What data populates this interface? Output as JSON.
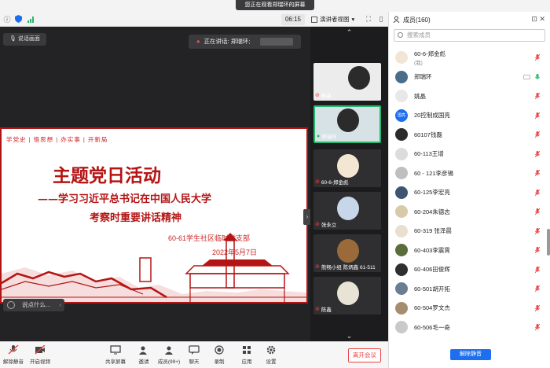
{
  "banner": "您正在观看郑瑞环的屏幕",
  "topbar": {
    "time": "06:15",
    "view_label": "演讲者视图"
  },
  "main": {
    "speaker_view_label": "说话画面",
    "speaking_label": "正在讲话: 郑瑞环;",
    "chat_placeholder": "说点什么..."
  },
  "slide": {
    "topline": "学党史 | 悟思想 | 办实事 | 开新局",
    "title": "主题党日活动",
    "subtitle1": "——学习习近平总书记在中国人民大学",
    "subtitle2": "考察时重要讲话精神",
    "org": "60-61学生社区临时党支部",
    "date": "2022年5月7日"
  },
  "videos": [
    {
      "name": "杨路"
    },
    {
      "name": "郑瑞环"
    },
    {
      "name": "60-6-郑金彪"
    },
    {
      "name": "张永立"
    },
    {
      "name": "熊畅小组 陈炳鑫 61-511"
    },
    {
      "name": "陈鑫"
    }
  ],
  "panel": {
    "title": "成员(160)",
    "search_placeholder": "搜索成员",
    "unmute_all": "解除静音",
    "members": [
      {
        "name": "60-6-郑金彪",
        "sub": "(我)",
        "avatar_color": "#f1e6d6",
        "avatar_text": ""
      },
      {
        "name": "郑瑞环",
        "sub": "",
        "avatar_color": "#4a6d8c",
        "avatar_text": ""
      },
      {
        "name": "姚晶",
        "sub": "",
        "avatar_color": "#e8e8e8",
        "avatar_text": ""
      },
      {
        "name": "20控制成国亮",
        "sub": "",
        "avatar_color": "#1e6ff0",
        "avatar_text": "国亮"
      },
      {
        "name": "60107钱磊",
        "sub": "",
        "avatar_color": "#2b2b2b",
        "avatar_text": ""
      },
      {
        "name": "60-113王增",
        "sub": "",
        "avatar_color": "#dcdcdc",
        "avatar_text": ""
      },
      {
        "name": "60 - 121李彦锡",
        "sub": "",
        "avatar_color": "#bfbfbf",
        "avatar_text": ""
      },
      {
        "name": "60-125李宏亮",
        "sub": "",
        "avatar_color": "#3d5570",
        "avatar_text": ""
      },
      {
        "name": "60-204朱德志",
        "sub": "",
        "avatar_color": "#d8c9a8",
        "avatar_text": ""
      },
      {
        "name": "60-319 张泽晨",
        "sub": "",
        "avatar_color": "#e9dfcf",
        "avatar_text": ""
      },
      {
        "name": "60-403李震霄",
        "sub": "",
        "avatar_color": "#5b6e3a",
        "avatar_text": ""
      },
      {
        "name": "60-406田俊辉",
        "sub": "",
        "avatar_color": "#2f2f2f",
        "avatar_text": ""
      },
      {
        "name": "60-501胡开拓",
        "sub": "",
        "avatar_color": "#6b7d93",
        "avatar_text": ""
      },
      {
        "name": "60-504罗文杰",
        "sub": "",
        "avatar_color": "#a58e6d",
        "avatar_text": ""
      },
      {
        "name": "60-506毛一奇",
        "sub": "",
        "avatar_color": "#c9c9c9",
        "avatar_text": ""
      }
    ]
  },
  "toolbar": {
    "mute": "解除静音",
    "video": "开启视频",
    "share": "共享屏幕",
    "invite": "邀请",
    "members": "成员(99+)",
    "chat": "聊天",
    "record": "录制",
    "apps": "应用",
    "settings": "设置",
    "leave": "离开会议"
  },
  "colors": {
    "accent": "#1e6ff0",
    "danger": "#e44444",
    "slide_red": "#b51414"
  }
}
